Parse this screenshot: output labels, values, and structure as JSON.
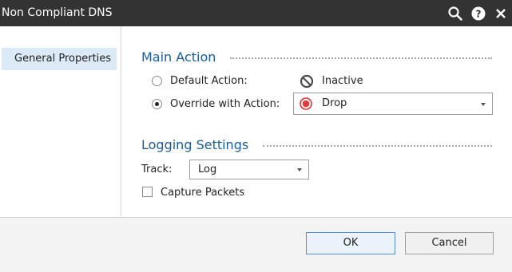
{
  "window": {
    "title": "Non Compliant DNS",
    "icons": [
      "search-icon",
      "help-icon",
      "close-icon"
    ]
  },
  "sidebar": {
    "items": [
      {
        "label": "General Properties",
        "selected": true
      }
    ]
  },
  "main_action": {
    "heading": "Main Action",
    "default_action": {
      "label": "Default Action:",
      "selected": false,
      "value": "Inactive",
      "value_icon": "prohibited-icon"
    },
    "override_action": {
      "label": "Override with Action:",
      "selected": true,
      "value": "Drop",
      "value_icon": "drop-icon"
    }
  },
  "logging": {
    "heading": "Logging Settings",
    "track_label": "Track:",
    "track_value": "Log",
    "capture_packets_label": "Capture Packets",
    "capture_packets_checked": false
  },
  "footer": {
    "ok_label": "OK",
    "cancel_label": "Cancel"
  },
  "colors": {
    "titlebar": "#333333",
    "section_heading": "#1b5c9e",
    "selection": "#dce9f6",
    "drop_red": "#e03a3a"
  }
}
